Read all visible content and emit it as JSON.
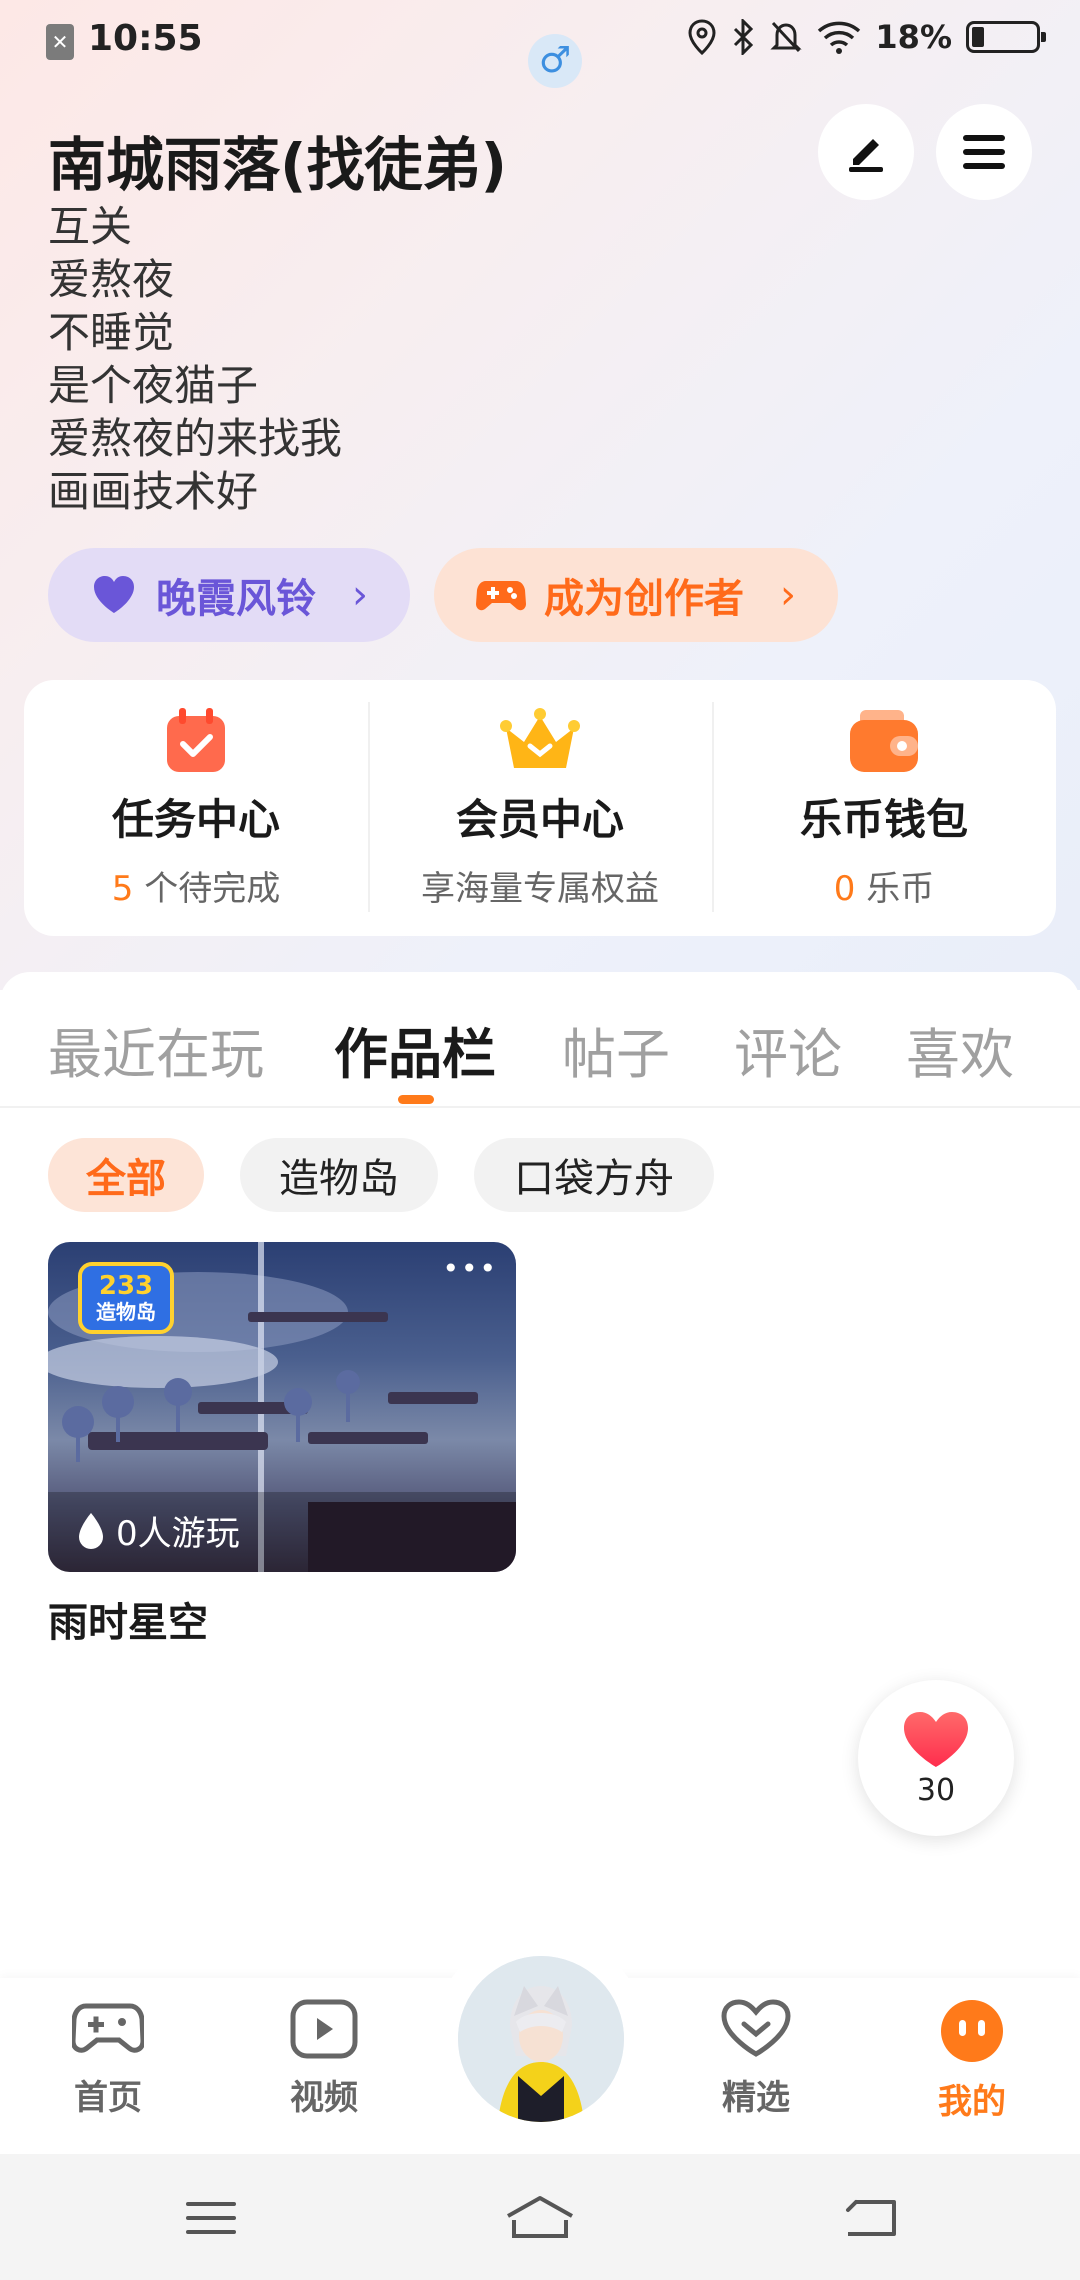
{
  "status_bar": {
    "time": "10:55",
    "gender_symbol": "♂",
    "battery_pct": "18%",
    "icons": [
      "sim-icon",
      "location-icon",
      "bluetooth-icon",
      "mute-bell-icon",
      "wifi-icon",
      "battery-icon"
    ]
  },
  "profile": {
    "name": "南城雨落(找徒弟)",
    "bio_lines": [
      "互关",
      "爱熬夜",
      "不睡觉",
      "是个夜猫子",
      "爱熬夜的来找我",
      "画画技术好"
    ],
    "edit_icon": "pencil-icon",
    "menu_icon": "hamburger-icon"
  },
  "chips": {
    "purple": {
      "label": "晚霞风铃",
      "arrow": "›",
      "icon": "heart-icon",
      "color": "#6a56d8"
    },
    "orange": {
      "label": "成为创作者",
      "arrow": "›",
      "icon": "gamepad-icon",
      "color": "#ff6a1a"
    }
  },
  "card": {
    "task": {
      "title": "任务中心",
      "count": "5",
      "sub": " 个待完成",
      "icon": "calendar-check-icon"
    },
    "member": {
      "title": "会员中心",
      "sub": "享海量专属权益",
      "icon": "crown-icon"
    },
    "wallet": {
      "title": "乐币钱包",
      "count": "0",
      "sub": " 乐币",
      "icon": "wallet-icon"
    }
  },
  "tabs": [
    "最近在玩",
    "作品栏",
    "帖子",
    "评论",
    "喜欢"
  ],
  "active_tab": "作品栏",
  "filters": [
    "全部",
    "造物岛",
    "口袋方舟"
  ],
  "active_filter": "全部",
  "work": {
    "badge_top": "233",
    "badge_bottom": "造物岛",
    "players": "0人游玩",
    "title": "雨时星空",
    "more": "•••"
  },
  "like": {
    "count": "30"
  },
  "bottom_nav": {
    "items": [
      "首页",
      "视频",
      "精选",
      "我的"
    ],
    "active": "我的"
  },
  "colors": {
    "accent": "#ff7a1a",
    "purple": "#6a56d8"
  }
}
